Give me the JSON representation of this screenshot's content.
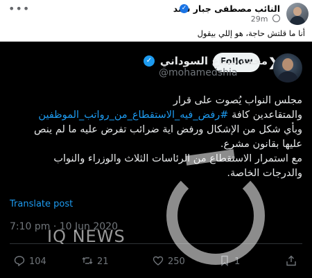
{
  "post": {
    "author": "النائب مصطفى جبار سند",
    "time": "29m",
    "caption": "أنا ما قلتش حاجة، هو إللي بيقول"
  },
  "tweet": {
    "name": "محمد شياع السوداني",
    "handle": "@mohamedshia",
    "follow_label": "Follow",
    "text_lines": [
      "مجلس النواب يُصوت على قرار",
      "#رفض_فيه_الاستقطاع_من_رواتب_الموظفين",
      "والمتقاعدين كافة",
      "وبأي شكل من الإشكال ورفض اية ضرائب تفرض عليه ما لم ينص",
      "عليها بقانون مشرع.",
      "مع استمرار الاستقطاع من الرئاسات الثلاث والوزراء والنواب",
      "والدرجات الخاصة."
    ],
    "translate_label": "Translate post",
    "timestamp": "7:10 pm · 10 Jun 2020",
    "actions": {
      "replies": "104",
      "reposts": "21",
      "likes": "250",
      "bookmarks": "1"
    }
  },
  "watermark": {
    "text": "IQ NEWS"
  },
  "icons": [
    "globe-icon",
    "verified-icon",
    "x-logo-icon",
    "reply-icon",
    "repost-icon",
    "like-icon",
    "bookmark-icon",
    "share-icon"
  ],
  "colors": {
    "accent": "#1d9bf0",
    "tweet_bg": "#000000",
    "fb_verified": "#1b74e4"
  }
}
